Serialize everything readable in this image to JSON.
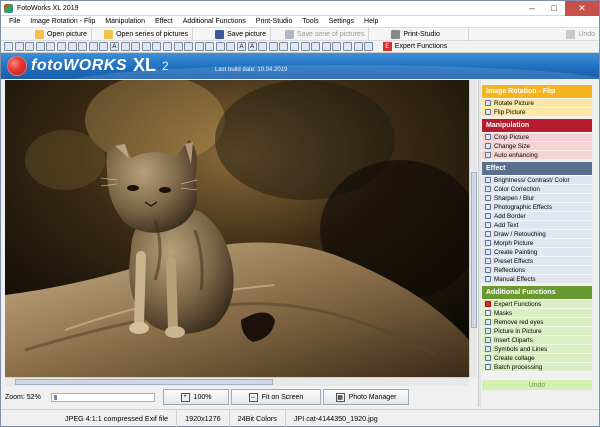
{
  "window": {
    "title": "FotoWorks XL 2019"
  },
  "menu": [
    "File",
    "Image Rotation - Flip",
    "Manipulation",
    "Effect",
    "Additional Functions",
    "Print-Studio",
    "Tools",
    "Settings",
    "Help"
  ],
  "toolbar": {
    "open_picture": "Open picture",
    "open_series": "Open series of pictures",
    "save_picture": "Save picture",
    "save_series": "Save serie of pictures",
    "print_studio": "Print-Studio",
    "undo": "Undo",
    "expert_functions": "Expert Functions"
  },
  "banner": {
    "logo": "fotoWORKS",
    "logo_xl": "XL",
    "logo_version": "2",
    "build_date": "Last build date: 10.04.2019"
  },
  "sections": [
    {
      "title": "Image Rotation - Flip",
      "color": "#f7b421",
      "items": [
        "Rotate Picture",
        "Flip Picture"
      ]
    },
    {
      "title": "Manipulation",
      "color": "#b71c2d",
      "items": [
        "Crop Picture",
        "Change Size",
        "Auto enhancing"
      ]
    },
    {
      "title": "Effect",
      "color": "#5a6f8f",
      "items": [
        "Brightness/ Contrast/ Color",
        "Color Correction",
        "Sharpen / Blur",
        "Photographic Effects",
        "Add Border",
        "Add Text",
        "Draw / Retouching",
        "Morph Picture",
        "Create Painting",
        "Preset Effects",
        "Reflections",
        "Manual Effects"
      ]
    },
    {
      "title": "Additional Functions",
      "color": "#6a9a2f",
      "items": [
        "Expert Functions",
        "Masks",
        "Remove red eyes",
        "Picture in Picture",
        "Insert Cliparts",
        "Symbols and Lines",
        "Create collage",
        "Batch processing"
      ]
    }
  ],
  "panel_undo": "Undo",
  "zoom": {
    "label": "Zoom: 52%",
    "btn_100": "100%",
    "btn_fit": "Fit on Screen",
    "btn_manager": "Photo Manager"
  },
  "status": {
    "format": "JPEG 4:1:1 compressed Exif file",
    "dimensions": "1920x1276",
    "colors": "24Bit Colors",
    "filename": "JPI cat-4144350_1920.jpg"
  }
}
